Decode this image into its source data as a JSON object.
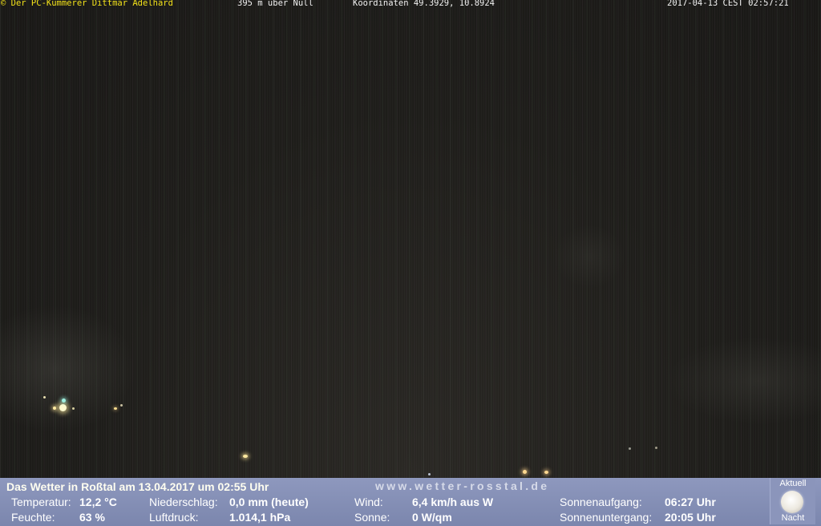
{
  "overlay": {
    "copyright": "© Der PC-Kümmerer Dittmar Adelhard",
    "altitude": "395 m über Null",
    "coordinates": "Koordinaten 49.3929, 10.8924",
    "timestamp": "2017-04-13 CEST 02:57:21"
  },
  "weather": {
    "headline": "Das Wetter in Roßtal am 13.04.2017 um 02:55 Uhr",
    "website": "www.wetter-rosstal.de",
    "temperature_label": "Temperatur:",
    "temperature_value": "12,2 °C",
    "humidity_label": "Feuchte:",
    "humidity_value": "63 %",
    "precip_label": "Niederschlag:",
    "precip_value": "0,0 mm (heute)",
    "pressure_label": "Luftdruck:",
    "pressure_value": "1.014,1 hPa",
    "wind_label": "Wind:",
    "wind_value": "6,4 km/h aus W",
    "sun_label": "Sonne:",
    "sun_value": "0 W/qm",
    "sunrise_label": "Sonnenaufgang:",
    "sunrise_value": "06:27 Uhr",
    "sunset_label": "Sonnenuntergang:",
    "sunset_value": "20:05 Uhr"
  },
  "moon": {
    "top_label": "Aktuell",
    "bottom_label": "Nacht",
    "icon": "full-moon-icon"
  },
  "colors": {
    "overlay_text": "#f3e21a",
    "bar_background": "#8e98be"
  }
}
